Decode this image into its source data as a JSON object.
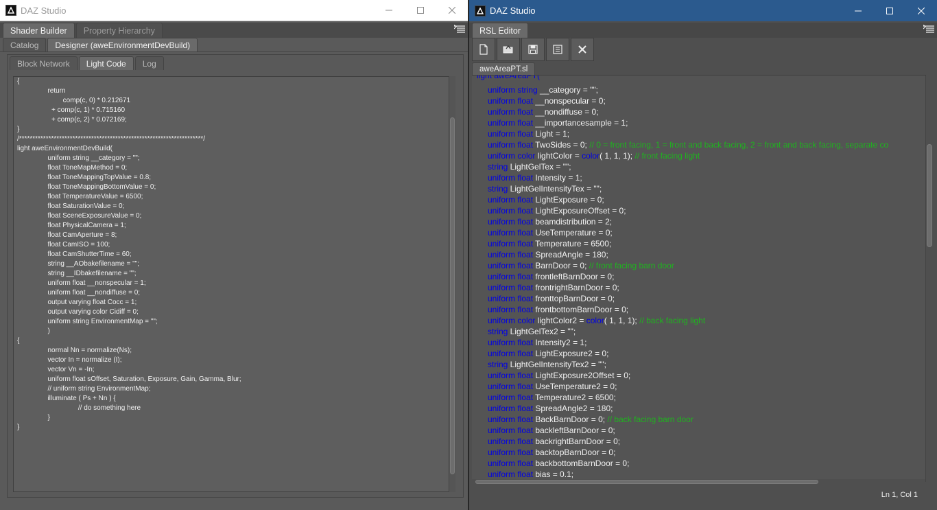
{
  "left": {
    "title": "DAZ Studio",
    "tabs": [
      "Shader Builder",
      "Property Hierarchy"
    ],
    "subtabs": [
      "Catalog",
      "Designer (aweEnvironmentDevBuild)"
    ],
    "innertabs": [
      "Block Network",
      "Light Code",
      "Log"
    ],
    "code_lines": [
      "{",
      "\t\treturn",
      "\t\t\tcomp(c, 0) * 0.212671",
      "\t\t  + comp(c, 1) * 0.715160",
      "\t\t  + comp(c, 2) * 0.072169;",
      "}",
      "/*********************************************************************/",
      "light aweEnvironmentDevBuild(",
      "\t\tuniform string __category = \"\";",
      "\t\tfloat ToneMapMethod = 0;",
      "\t\tfloat ToneMappingTopValue = 0.8;",
      "\t\tfloat ToneMappingBottomValue = 0;",
      "\t\tfloat TemperatureValue = 6500;",
      "\t\tfloat SaturationValue = 0;",
      "\t\tfloat SceneExposureValue = 0;",
      "\t\tfloat PhysicalCamera = 1;",
      "\t\tfloat CamAperture = 8;",
      "\t\tfloat CamISO = 100;",
      "\t\tfloat CamShutterTime = 60;",
      "\t\tstring __AObakefilename = \"\";",
      "\t\tstring __IDbakefilename = \"\";",
      "\t\tuniform float __nonspecular = 1;",
      "\t\tuniform float __nondiffuse = 0;",
      "\t\toutput varying float Cocc = 1;",
      "\t\toutput varying color Cidiff = 0;",
      "\t\tuniform string EnvironmentMap = \"\";",
      "\t\t)",
      "{",
      "\t\tnormal Nn = normalize(Ns);",
      "\t\tvector In = normalize (I);",
      "\t\tvector Vn = -In;",
      "",
      "\t\tuniform float sOffset, Saturation, Exposure, Gain, Gamma, Blur;",
      "\t\t// uniform string EnvironmentMap;",
      "",
      "\t\tilluminate ( Ps + Nn ) {",
      "\t\t\t\t// do something here",
      "\t\t}",
      "",
      "",
      "}"
    ]
  },
  "right": {
    "title": "DAZ Studio",
    "tab": "RSL Editor",
    "file_tab": "aweAreaPT.sl",
    "toolbar": [
      "new-file-icon",
      "open-folder-icon",
      "save-icon",
      "compile-icon",
      "close-icon"
    ],
    "status": "Ln 1, Col 1",
    "first_line": "light aweAreaPT(",
    "code_lines": [
      [
        [
          "kw",
          "uniform string"
        ],
        [
          "t",
          " __category = \"\";"
        ]
      ],
      [
        [
          "kw",
          "uniform float"
        ],
        [
          "t",
          " __nonspecular = 0;"
        ]
      ],
      [
        [
          "kw",
          "uniform float"
        ],
        [
          "t",
          " __nondiffuse = 0;"
        ]
      ],
      [
        [
          "kw",
          "uniform float"
        ],
        [
          "t",
          " __importancesample = 1;"
        ]
      ],
      [
        [
          "kw",
          "uniform float"
        ],
        [
          "t",
          " Light = 1;"
        ]
      ],
      [
        [
          "kw",
          "uniform float"
        ],
        [
          "t",
          " TwoSides = 0; "
        ],
        [
          "cm",
          "// 0 = front facing, 1 = front and back facing, 2 = front and back facing, separate co"
        ]
      ],
      [
        [
          "kw",
          "uniform color"
        ],
        [
          "t",
          " lightColor = "
        ],
        [
          "kw",
          "color"
        ],
        [
          "t",
          "( 1, 1, 1); "
        ],
        [
          "cm",
          "// front facing light"
        ]
      ],
      [
        [
          "kw",
          "string"
        ],
        [
          "t",
          " LightGelTex = \"\";"
        ]
      ],
      [
        [
          "kw",
          "uniform float"
        ],
        [
          "t",
          " Intensity = 1;"
        ]
      ],
      [
        [
          "kw",
          "string"
        ],
        [
          "t",
          " LightGelIntensityTex = \"\";"
        ]
      ],
      [
        [
          "kw",
          "uniform float"
        ],
        [
          "t",
          " LightExposure = 0;"
        ]
      ],
      [
        [
          "kw",
          "uniform float"
        ],
        [
          "t",
          " LightExposureOffset = 0;"
        ]
      ],
      [
        [
          "kw",
          "uniform float"
        ],
        [
          "t",
          " beamdistribution = 2;"
        ]
      ],
      [
        [
          "kw",
          "uniform float"
        ],
        [
          "t",
          " UseTemperature = 0;"
        ]
      ],
      [
        [
          "kw",
          "uniform float"
        ],
        [
          "t",
          " Temperature = 6500;"
        ]
      ],
      [
        [
          "kw",
          "uniform float"
        ],
        [
          "t",
          " SpreadAngle = 180;"
        ]
      ],
      [
        [
          "kw",
          "uniform float"
        ],
        [
          "t",
          " BarnDoor = 0; "
        ],
        [
          "cm",
          "// front facing barn door"
        ]
      ],
      [
        [
          "kw",
          "uniform float"
        ],
        [
          "t",
          " frontleftBarnDoor = 0;"
        ]
      ],
      [
        [
          "kw",
          "uniform float"
        ],
        [
          "t",
          " frontrightBarnDoor = 0;"
        ]
      ],
      [
        [
          "kw",
          "uniform float"
        ],
        [
          "t",
          " fronttopBarnDoor = 0;"
        ]
      ],
      [
        [
          "kw",
          "uniform float"
        ],
        [
          "t",
          " frontbottomBarnDoor = 0;"
        ]
      ],
      [
        [
          "kw",
          "uniform color"
        ],
        [
          "t",
          " lightColor2 = "
        ],
        [
          "kw",
          "color"
        ],
        [
          "t",
          "( 1, 1, 1); "
        ],
        [
          "cm",
          "// back facing light"
        ]
      ],
      [
        [
          "kw",
          "string"
        ],
        [
          "t",
          " LightGelTex2 = \"\";"
        ]
      ],
      [
        [
          "kw",
          "uniform float"
        ],
        [
          "t",
          " Intensity2 = 1;"
        ]
      ],
      [
        [
          "kw",
          "uniform float"
        ],
        [
          "t",
          " LightExposure2 = 0;"
        ]
      ],
      [
        [
          "kw",
          "string"
        ],
        [
          "t",
          " LightGelIntensityTex2 = \"\";"
        ]
      ],
      [
        [
          "kw",
          "uniform float"
        ],
        [
          "t",
          " LightExposure2Offset = 0;"
        ]
      ],
      [
        [
          "kw",
          "uniform float"
        ],
        [
          "t",
          " UseTemperature2 = 0;"
        ]
      ],
      [
        [
          "kw",
          "uniform float"
        ],
        [
          "t",
          " Temperature2 = 6500;"
        ]
      ],
      [
        [
          "kw",
          "uniform float"
        ],
        [
          "t",
          " SpreadAngle2 = 180;"
        ]
      ],
      [
        [
          "kw",
          "uniform float"
        ],
        [
          "t",
          " BackBarnDoor = 0; "
        ],
        [
          "cm",
          "// back facing barn door"
        ]
      ],
      [
        [
          "kw",
          "uniform float"
        ],
        [
          "t",
          " backleftBarnDoor = 0;"
        ]
      ],
      [
        [
          "kw",
          "uniform float"
        ],
        [
          "t",
          " backrightBarnDoor = 0;"
        ]
      ],
      [
        [
          "kw",
          "uniform float"
        ],
        [
          "t",
          " backtopBarnDoor = 0;"
        ]
      ],
      [
        [
          "kw",
          "uniform float"
        ],
        [
          "t",
          " backbottomBarnDoor = 0;"
        ]
      ],
      [
        [
          "kw",
          "uniform float"
        ],
        [
          "t",
          " bias = 0.1;"
        ]
      ]
    ]
  },
  "colors": {
    "keyword": "#0000e6",
    "comment": "#1fb31f",
    "titlebar_active": "#2b5a8e"
  }
}
